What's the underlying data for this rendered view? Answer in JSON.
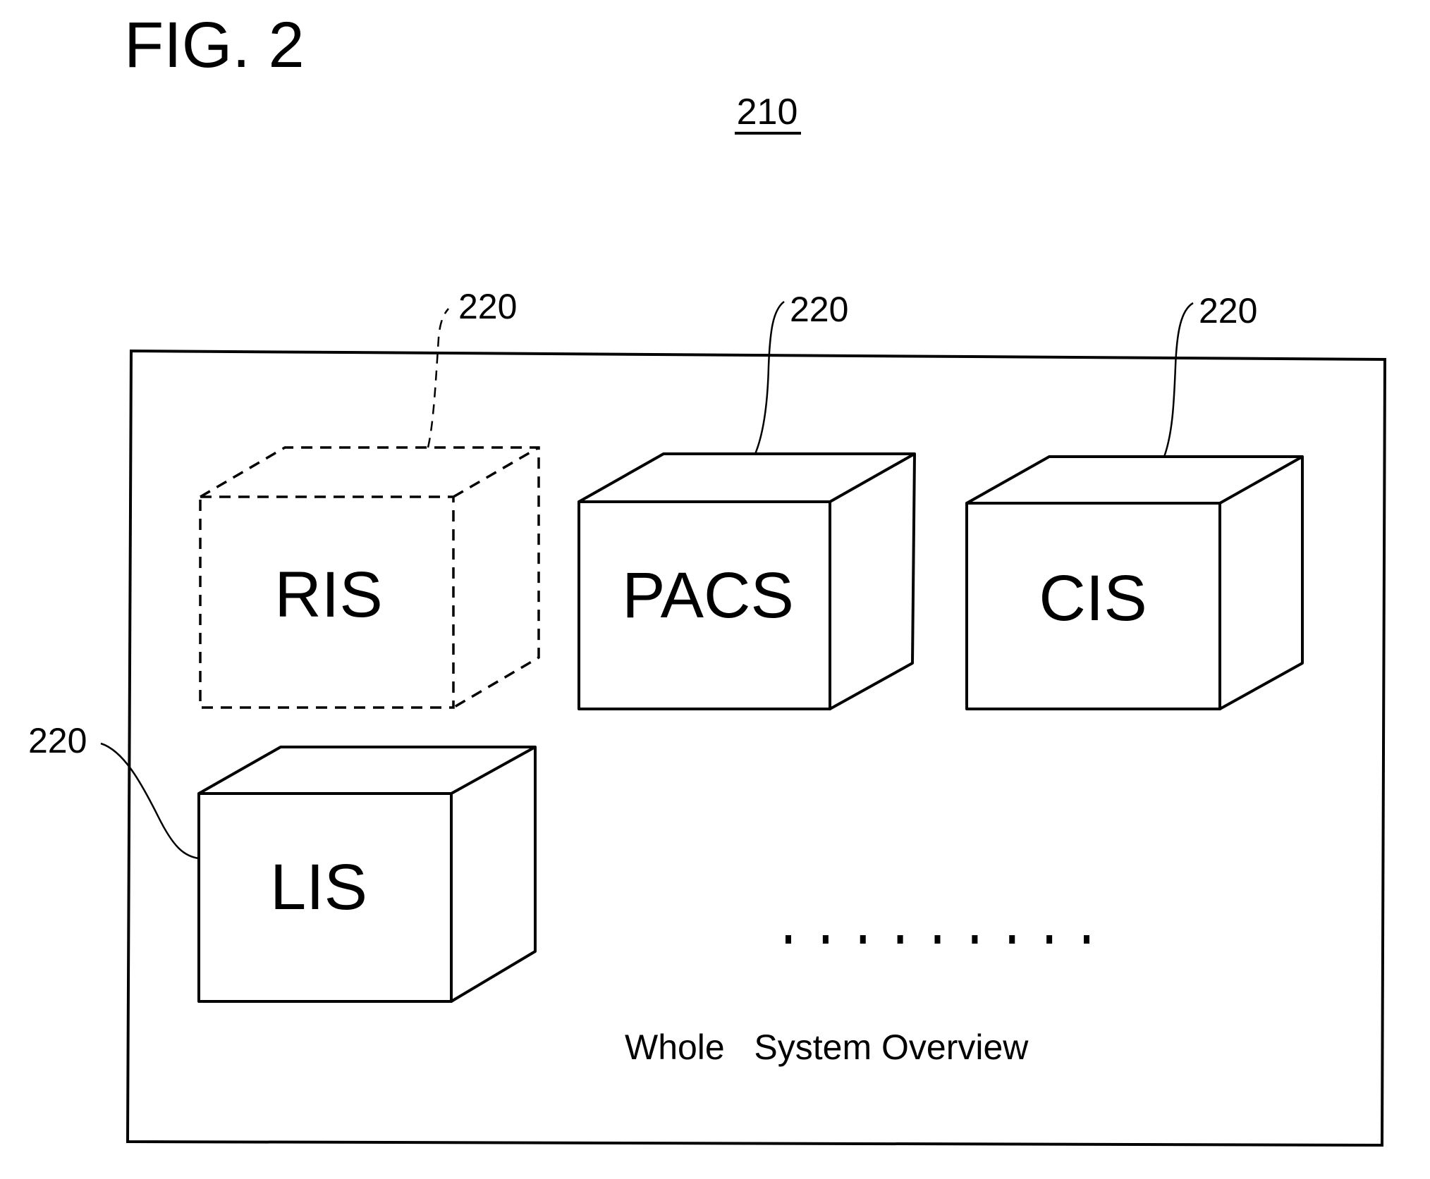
{
  "figure": {
    "title": "FIG. 2",
    "reference": "210",
    "caption": "Whole   System Overview"
  },
  "systems": [
    {
      "name": "RIS",
      "ref": "220",
      "style": "dashed"
    },
    {
      "name": "PACS",
      "ref": "220",
      "style": "solid"
    },
    {
      "name": "CIS",
      "ref": "220",
      "style": "solid"
    },
    {
      "name": "LIS",
      "ref": "220",
      "style": "solid"
    }
  ],
  "ellipsis": {
    "dot_count": 9
  },
  "colors": {
    "ink": "#000000",
    "paper": "#ffffff"
  }
}
